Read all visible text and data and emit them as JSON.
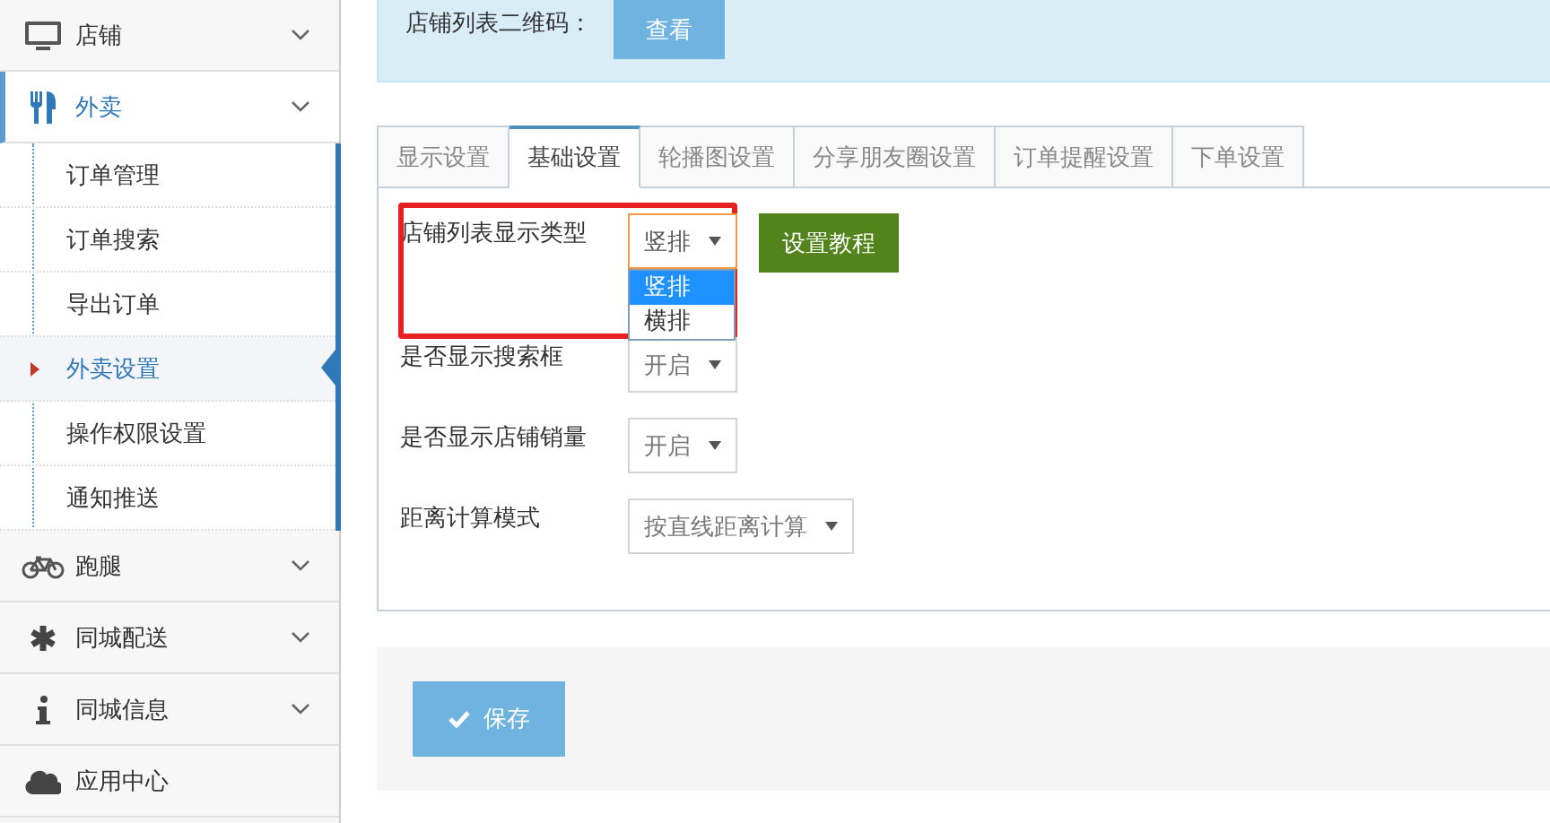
{
  "sidebar": {
    "items": [
      {
        "label": "店铺",
        "expanded": false,
        "has_caret": true
      },
      {
        "label": "外卖",
        "expanded": true,
        "has_caret": true,
        "children": [
          {
            "label": "订单管理",
            "selected": false
          },
          {
            "label": "订单搜索",
            "selected": false
          },
          {
            "label": "导出订单",
            "selected": false
          },
          {
            "label": "外卖设置",
            "selected": true
          },
          {
            "label": "操作权限设置",
            "selected": false
          },
          {
            "label": "通知推送",
            "selected": false
          }
        ]
      },
      {
        "label": "跑腿",
        "expanded": false,
        "has_caret": true
      },
      {
        "label": "同城配送",
        "expanded": false,
        "has_caret": true
      },
      {
        "label": "同城信息",
        "expanded": false,
        "has_caret": true
      },
      {
        "label": "应用中心",
        "expanded": false,
        "has_caret": false
      }
    ]
  },
  "info_panel": {
    "label": "店铺列表二维码：",
    "button": "查看"
  },
  "tabs": [
    {
      "label": "显示设置",
      "selected": false
    },
    {
      "label": "基础设置",
      "selected": true
    },
    {
      "label": "轮播图设置",
      "selected": false
    },
    {
      "label": "分享朋友圈设置",
      "selected": false
    },
    {
      "label": "订单提醒设置",
      "selected": false
    },
    {
      "label": "下单设置",
      "selected": false
    }
  ],
  "settings": [
    {
      "label": "店铺列表显示类型",
      "value": "竖排",
      "highlighted": true,
      "tutorial_button": "设置教程",
      "options": [
        {
          "label": "竖排",
          "selected": true
        },
        {
          "label": "横排",
          "selected": false
        }
      ]
    },
    {
      "label": "是否显示搜索框",
      "value": "开启"
    },
    {
      "label": "是否显示店铺销量",
      "value": "开启"
    },
    {
      "label": "距离计算模式",
      "value": "按直线距离计算"
    }
  ],
  "save_button": "保存"
}
